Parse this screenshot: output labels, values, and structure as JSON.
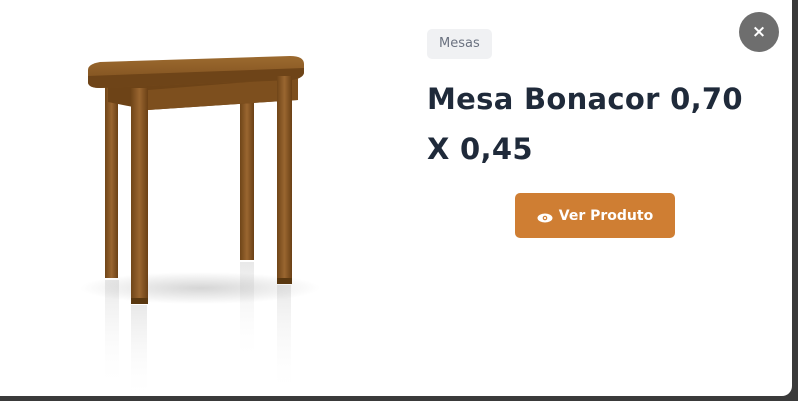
{
  "modal": {
    "category": "Mesas",
    "product_name": "Mesa Bonacor 0,70 X 0,45",
    "view_button_label": "Ver Produto",
    "close_symbol": "×",
    "image_alt": "Mesa Bonacor 0,70 X 0,45",
    "icons": {
      "view": "eye-icon",
      "close": "close-icon"
    },
    "colors": {
      "button": "#cf7e33",
      "title": "#1f2a3a",
      "badge_bg": "#f0f1f3",
      "close_bg": "#6e6e6e",
      "wood": "#8a5a23"
    }
  }
}
